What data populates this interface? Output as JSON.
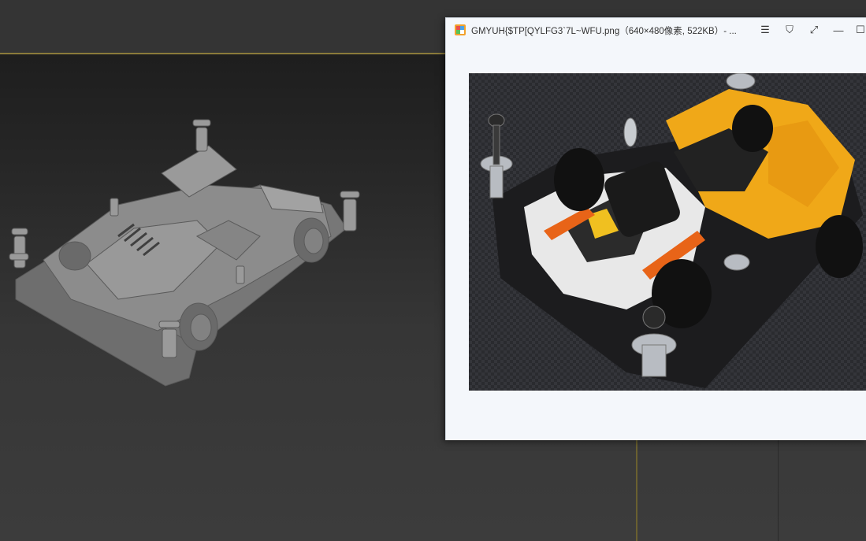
{
  "viewer": {
    "title": "GMYUH{$TP[QYLFG3`7L~WFU.png（640×480像素, 522KB）- ...",
    "icons": {
      "app": "image-viewer-app-icon",
      "menu": "hamburger-menu-icon",
      "pin": "pin-icon",
      "fullscreen": "fullscreen-icon",
      "minimize": "minimize-icon",
      "maximize": "maximize-icon"
    },
    "buttons": {
      "menu": "☰",
      "pin": "⛉",
      "fullscreen": "⤢",
      "minimize": "—",
      "maximize": "☐"
    }
  },
  "colors": {
    "viewport_bg": "#2a2a2a",
    "frame_accent": "#8a7a3a",
    "viewer_bg": "#f4f7fb",
    "car_body": "#f0a818",
    "car_white": "#e8e8e8"
  }
}
